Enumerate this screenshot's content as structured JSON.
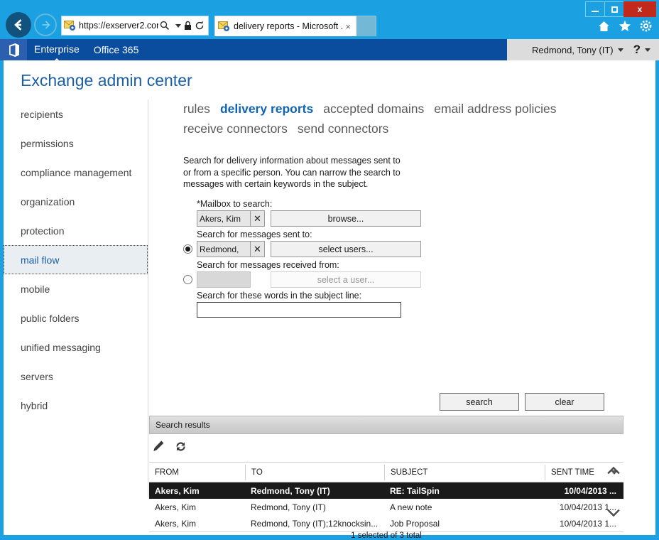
{
  "browser": {
    "address_value": "https://exserver2.con...",
    "tab_title": "delivery reports - Microsoft ...",
    "tab_close_label": "×",
    "back_label": "Back",
    "forward_label": "Forward",
    "new_tab_label": "New tab",
    "home_label": "Home",
    "favorites_label": "Favorites",
    "tools_label": "Tools",
    "minimize_label": "Minimize",
    "maximize_label": "Maximize",
    "close_label": "x"
  },
  "suite_bar": {
    "enterprise_label": "Enterprise",
    "office_label": "Office 365",
    "user_name": "Redmond, Tony (IT)",
    "help_label": "?"
  },
  "page": {
    "title": "Exchange admin center"
  },
  "sidebar": {
    "items": [
      {
        "label": "recipients",
        "selected": false
      },
      {
        "label": "permissions",
        "selected": false
      },
      {
        "label": "compliance management",
        "selected": false
      },
      {
        "label": "organization",
        "selected": false
      },
      {
        "label": "protection",
        "selected": false
      },
      {
        "label": "mail flow",
        "selected": true
      },
      {
        "label": "mobile",
        "selected": false
      },
      {
        "label": "public folders",
        "selected": false
      },
      {
        "label": "unified messaging",
        "selected": false
      },
      {
        "label": "servers",
        "selected": false
      },
      {
        "label": "hybrid",
        "selected": false
      }
    ]
  },
  "tabs": [
    {
      "label": "rules",
      "active": false
    },
    {
      "label": "delivery reports",
      "active": true
    },
    {
      "label": "accepted domains",
      "active": false
    },
    {
      "label": "email address policies",
      "active": false
    },
    {
      "label": "receive connectors",
      "active": false
    },
    {
      "label": "send connectors",
      "active": false
    }
  ],
  "intro": {
    "text": "Search for delivery information about messages sent to or from a specific person. You can narrow the search to messages with certain keywords in the subject."
  },
  "form": {
    "mailbox_label": "*Mailbox to search:",
    "mailbox_token": "Akers, Kim",
    "mailbox_remove": "✕",
    "browse_label": "browse...",
    "sent_to_label": "Search for messages sent to:",
    "sent_to_token": "Redmond,",
    "sent_to_remove": "✕",
    "select_users_label": "select users...",
    "sent_to_selected": true,
    "received_from_label": "Search for messages received from:",
    "received_from_token": "",
    "select_a_user_label": "select a user...",
    "received_from_selected": false,
    "subject_label": "Search for these words in the subject line:",
    "subject_value": "",
    "subject_placeholder": ""
  },
  "actions": {
    "search_label": "search",
    "clear_label": "clear"
  },
  "results": {
    "banner_label": "Search results",
    "toolbar": [
      {
        "icon": "pencil-icon",
        "label": "Edit"
      },
      {
        "icon": "refresh-icon",
        "label": "Refresh"
      }
    ],
    "columns": [
      {
        "key": "from",
        "label": "FROM"
      },
      {
        "key": "to",
        "label": "TO"
      },
      {
        "key": "subject",
        "label": "SUBJECT"
      },
      {
        "key": "sent_time",
        "label": "SENT TIME",
        "sorted": true,
        "sort_dir": "desc"
      }
    ],
    "rows": [
      {
        "from": "Akers, Kim",
        "to": "Redmond, Tony (IT)",
        "subject": "RE: TailSpin",
        "sent_time": "10/04/2013 ...",
        "selected": true
      },
      {
        "from": "Akers, Kim",
        "to": "Redmond, Tony (IT)",
        "subject": "A new note",
        "sent_time": "10/04/2013 1...",
        "selected": false
      },
      {
        "from": "Akers, Kim",
        "to": "Redmond, Tony (IT);12knocksin...",
        "subject": "Job Proposal",
        "sent_time": "10/04/2013 1...",
        "selected": false
      }
    ],
    "count_text": "1 selected of 3 total",
    "scroll_up_label": "Scroll up",
    "scroll_down_label": "Scroll down"
  },
  "colors": {
    "chrome_blue": "#1ba1e2",
    "suite_blue": "#0a4d9e",
    "accent_link": "#1164b4",
    "title_blue": "#1b5fa8",
    "close_red": "#c1291c"
  }
}
